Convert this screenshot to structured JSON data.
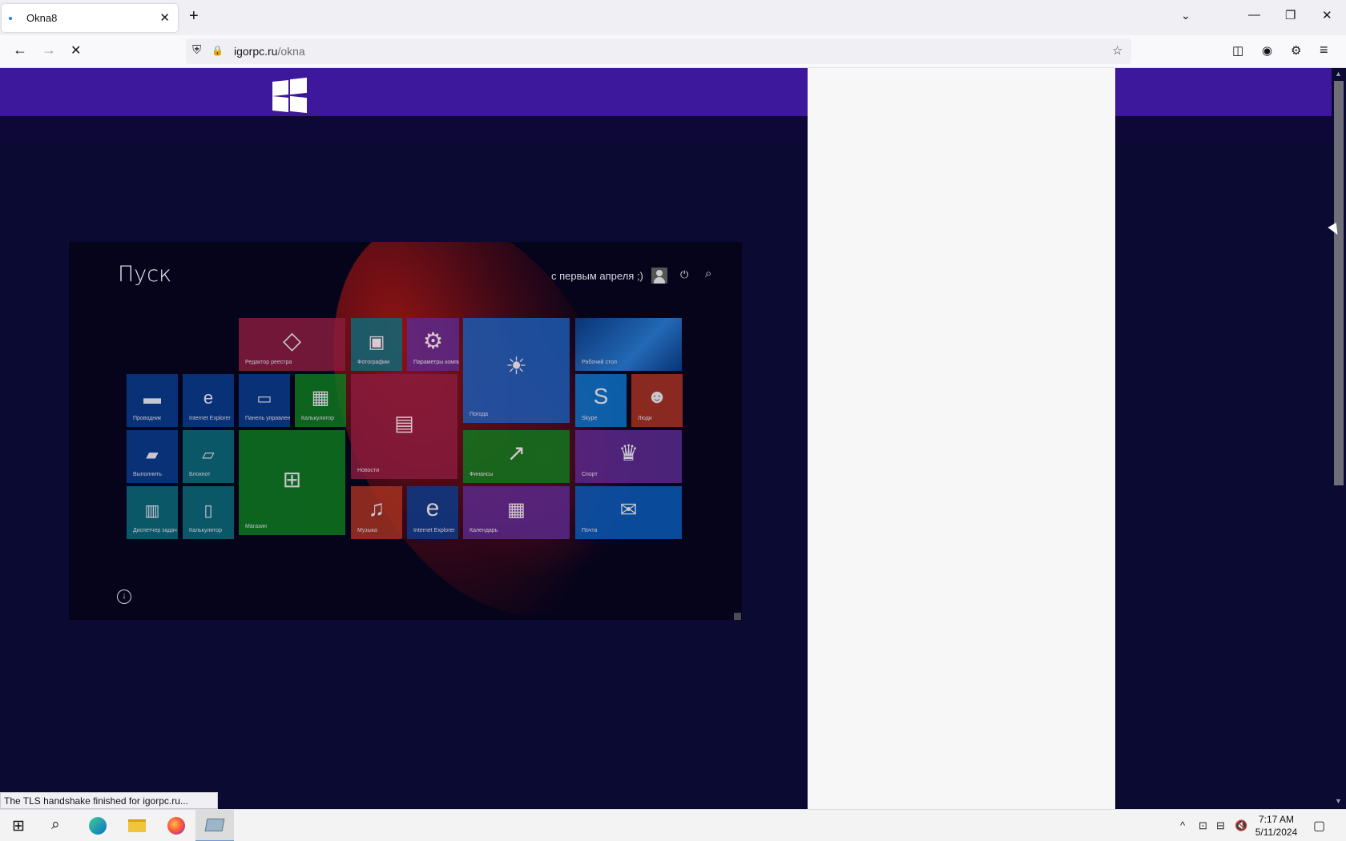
{
  "browser": {
    "tab_title": "Okna8",
    "tab_close": "✕",
    "new_tab": "+",
    "list_tabs": "⌄",
    "minimize": "—",
    "restore": "❐",
    "close": "✕",
    "back": "←",
    "forward": "→",
    "stop": "✕",
    "url_host": "igorpc.ru",
    "url_path": "/okna",
    "shield": "⛨",
    "lock": "🔒",
    "bookmark": "☆",
    "pocket": "◫",
    "account": "◉",
    "extensions": "⚙",
    "menu": "≡"
  },
  "start_screen": {
    "title": "Пуск",
    "user_name": "с первым апреля ;)",
    "power_icon": "⏻",
    "search_icon": "⌕",
    "all_apps_icon": "↓",
    "tiles": [
      {
        "label": "Редактор реестра",
        "icon": "◇",
        "color": "#8a1c3e"
      },
      {
        "label": "Фотографии",
        "icon": "▣",
        "color": "#0c6a7a"
      },
      {
        "label": "Параметры компьютера",
        "icon": "⚙",
        "color": "#5b2a8e"
      },
      {
        "label": "Погода",
        "icon": "☀",
        "color": "#1a5db8"
      },
      {
        "label": "Рабочий стол",
        "icon": "",
        "color": "#0a4da0"
      },
      {
        "label": "Проводник",
        "icon": "▬",
        "color": "#0b3b8c"
      },
      {
        "label": "Internet Explorer",
        "icon": "e",
        "color": "#0b3b8c"
      },
      {
        "label": "Панель управления",
        "icon": "▭",
        "color": "#0b3b8c"
      },
      {
        "label": "Калькулятор",
        "icon": "▦",
        "color": "#0f7a1f"
      },
      {
        "label": "Новости",
        "icon": "▤",
        "color": "#8a1c3e"
      },
      {
        "label": "Skype",
        "icon": "S",
        "color": "#0b73c8"
      },
      {
        "label": "Люди",
        "icon": "☻",
        "color": "#a83221"
      },
      {
        "label": "Выполнить",
        "icon": "▰",
        "color": "#0b3b8c"
      },
      {
        "label": "Блокнот",
        "icon": "▱",
        "color": "#0c6a7a"
      },
      {
        "label": "Магазин",
        "icon": "⊞",
        "color": "#0f7a1f"
      },
      {
        "label": "Финансы",
        "icon": "↗",
        "color": "#0f7a1f"
      },
      {
        "label": "Спорт",
        "icon": "♛",
        "color": "#5b2a8e"
      },
      {
        "label": "Диспетчер задач",
        "icon": "▥",
        "color": "#0c6a7a"
      },
      {
        "label": "Калькулятор",
        "icon": "▯",
        "color": "#0c6a7a"
      },
      {
        "label": "Музыка",
        "icon": "♫",
        "color": "#a83221"
      },
      {
        "label": "Internet Explorer",
        "icon": "e",
        "color": "#0b3b8c"
      },
      {
        "label": "Календарь",
        "icon": "▦",
        "color": "#5b2a8e"
      },
      {
        "label": "Почта",
        "icon": "✉",
        "color": "#0b5ab8"
      }
    ]
  },
  "status_text": "The TLS handshake finished for igorpc.ru...",
  "taskbar": {
    "start_icon": "⊞",
    "search_icon": "⌕",
    "tray_chevron": "^",
    "tray_icons": [
      "⊡",
      "⊟",
      "🔇"
    ],
    "time": "7:17 AM",
    "date": "5/11/2024",
    "notifications": "▢"
  },
  "colors": {
    "banner": "#3d189c",
    "page_bg": "#0b0a33",
    "blank_panel": "#f7f7f7"
  }
}
